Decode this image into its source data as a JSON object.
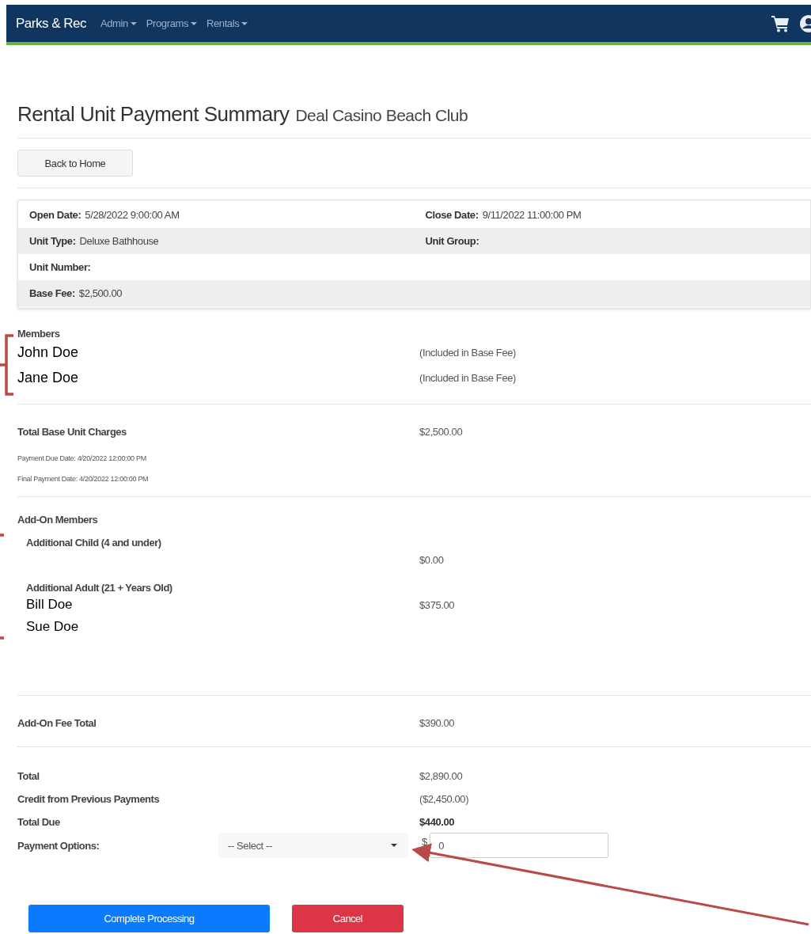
{
  "navbar": {
    "brand": "Parks & Rec",
    "menus": [
      {
        "label": "Admin"
      },
      {
        "label": "Programs"
      },
      {
        "label": "Rentals"
      }
    ]
  },
  "page_title": {
    "title": "Rental Unit Payment Summary",
    "subtitle": "Deal Casino Beach Club"
  },
  "back_button": "Back to Home",
  "details": [
    {
      "cells": [
        {
          "label": "Open Date:",
          "value": "5/28/2022 9:00:00 AM"
        },
        {
          "label": "Close Date:",
          "value": "9/11/2022 11:00:00 PM"
        }
      ]
    },
    {
      "cells": [
        {
          "label": "Unit Type:",
          "value": "Deluxe Bathhouse"
        },
        {
          "label": "Unit Group:"
        }
      ]
    },
    {
      "cells": [
        {
          "label": "Unit Number:"
        }
      ]
    },
    {
      "cells": [
        {
          "label": "Base Fee:",
          "value": "$2,500.00"
        }
      ]
    }
  ],
  "members": {
    "heading": "Members",
    "items": [
      {
        "name": "John Doe",
        "note": "(Included in Base Fee)"
      },
      {
        "name": "Jane Doe",
        "note": "(Included in Base Fee)"
      }
    ]
  },
  "base_charges": {
    "label": "Total Base Unit Charges",
    "amount": "$2,500.00",
    "dates": [
      {
        "label": "Payment Due Date:",
        "value": "4/20/2022 12:00:00 PM"
      },
      {
        "label": "Final Payment Date:",
        "value": "4/20/2022 12:00:00 PM"
      }
    ]
  },
  "add_on_members": {
    "heading": "Add-On Members",
    "groups": [
      {
        "title": "Additional Child (4 and under)",
        "amount": "$0.00"
      },
      {
        "title": "Additional Adult (21 + Years Old)",
        "amount": "$375.00",
        "names": [
          "Bill Doe",
          "Sue Doe"
        ]
      }
    ]
  },
  "add_on_total": {
    "label": "Add-On Fee Total",
    "amount": "$390.00"
  },
  "totals": [
    {
      "label": "Total",
      "amount": "$2,890.00",
      "bold": false
    },
    {
      "label": "Credit from Previous Payments",
      "amount": "($2,450.00)",
      "bold": false
    },
    {
      "label": "Total Due",
      "amount": "$440.00",
      "bold": true
    }
  ],
  "payment": {
    "label": "Payment Options:",
    "select": "-- Select --",
    "currency": "$",
    "amount": "0"
  },
  "buttons": [
    {
      "label": "Complete Processing",
      "kind": "primary"
    },
    {
      "label": "Cancel",
      "kind": "danger"
    }
  ]
}
